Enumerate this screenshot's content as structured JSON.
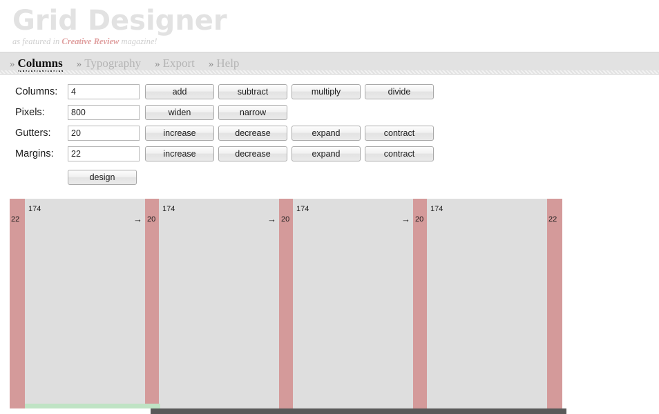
{
  "header": {
    "title": "Grid Designer",
    "tagline_before": "as featured in ",
    "tagline_magazine": "Creative Review",
    "tagline_after": " magazine!"
  },
  "nav": {
    "chevron": "»",
    "items": [
      {
        "label": "Columns",
        "active": true
      },
      {
        "label": "Typography",
        "active": false
      },
      {
        "label": "Export",
        "active": false
      },
      {
        "label": "Help",
        "active": false
      }
    ]
  },
  "controls": {
    "rows": [
      {
        "label": "Columns:",
        "value": "4",
        "buttons": [
          "add",
          "subtract",
          "multiply",
          "divide"
        ]
      },
      {
        "label": "Pixels:",
        "value": "800",
        "buttons": [
          "widen",
          "narrow"
        ]
      },
      {
        "label": "Gutters:",
        "value": "20",
        "buttons": [
          "increase",
          "decrease",
          "expand",
          "contract"
        ]
      },
      {
        "label": "Margins:",
        "value": "22",
        "buttons": [
          "increase",
          "decrease",
          "expand",
          "contract"
        ]
      }
    ],
    "design_button": "design"
  },
  "grid_preview": {
    "margin_label": "22",
    "gutter_label": "20",
    "column_label": "174",
    "arrow": "→",
    "segments": [
      {
        "type": "margin",
        "label": "22"
      },
      {
        "type": "column",
        "label": "174",
        "arrow": ""
      },
      {
        "type": "gutter",
        "label": "20"
      },
      {
        "type": "column",
        "label": "174",
        "arrow": ""
      },
      {
        "type": "gutter",
        "label": "20"
      },
      {
        "type": "column",
        "label": "174",
        "arrow": ""
      },
      {
        "type": "gutter",
        "label": "20"
      },
      {
        "type": "column",
        "label": "174",
        "arrow": ""
      },
      {
        "type": "margin",
        "label": "22"
      }
    ]
  },
  "colors": {
    "margin_bar": "#d49a9a",
    "gutter_bar": "#d49a9a",
    "column_block": "#dedede",
    "navbar_bg": "#e2e2e2",
    "title_gray": "#e2e2e2",
    "magazine_accent": "#e0a0a0",
    "green_strip": "#bfe3c4",
    "scrollbar_thumb": "#595959"
  }
}
